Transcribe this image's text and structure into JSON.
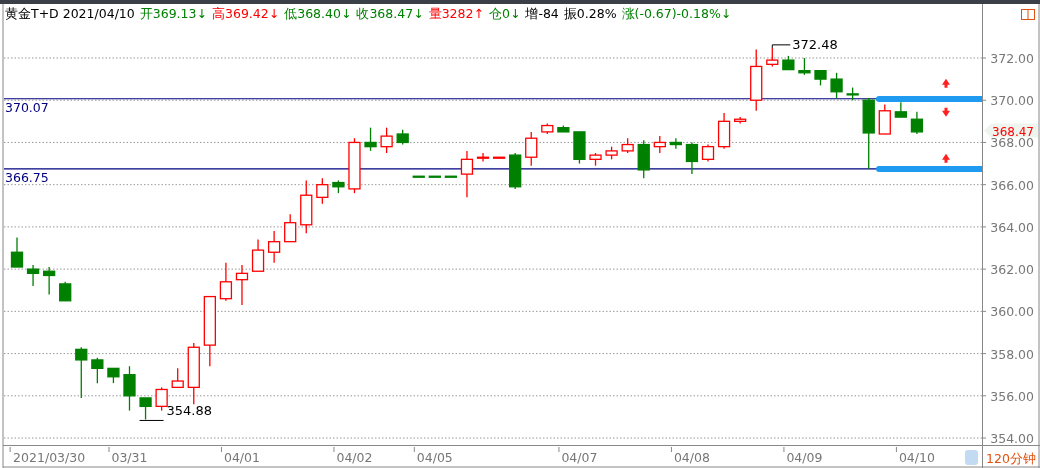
{
  "header": {
    "title": "黄金T+D 2021/04/10",
    "items": [
      {
        "text": "开369.13↓",
        "color": "#008000"
      },
      {
        "text": "高369.42↓",
        "color": "#ff0000"
      },
      {
        "text": "低368.40↓",
        "color": "#008000"
      },
      {
        "text": "收368.47↓",
        "color": "#008000"
      },
      {
        "text": "量3282↑",
        "color": "#ff0000"
      },
      {
        "text": "仓0↓",
        "color": "#008000"
      },
      {
        "text": "增-84",
        "color": "#000000"
      },
      {
        "text": "振0.28%",
        "color": "#000000"
      },
      {
        "text": "涨(-0.67)-0.18%↓",
        "color": "#008000"
      }
    ]
  },
  "chart_data": {
    "type": "candlestick",
    "categories": [
      null,
      null,
      "2021/03/30",
      null,
      null,
      null,
      null,
      "03/31",
      null,
      null,
      null,
      null,
      null,
      null,
      "04/01",
      null,
      null,
      null,
      null,
      null,
      null,
      "04/02",
      null,
      null,
      null,
      null,
      "04/05",
      null,
      null,
      null,
      null,
      null,
      null,
      null,
      null,
      "04/07",
      null,
      null,
      null,
      null,
      null,
      null,
      "04/08",
      null,
      null,
      null,
      null,
      null,
      null,
      "04/09",
      null,
      null,
      null,
      null,
      null,
      null,
      "04/10"
    ],
    "grid": true,
    "ohlc": [
      [
        362.8,
        363.5,
        362.1,
        362.1
      ],
      [
        362.0,
        362.2,
        361.2,
        361.8
      ],
      [
        361.9,
        362.1,
        360.8,
        361.7
      ],
      [
        361.3,
        361.4,
        360.5,
        360.5
      ],
      [
        358.2,
        358.3,
        355.9,
        357.7
      ],
      [
        357.7,
        357.8,
        356.6,
        357.3
      ],
      [
        357.3,
        357.3,
        356.6,
        356.9
      ],
      [
        357.0,
        357.4,
        355.3,
        356.0
      ],
      [
        355.9,
        355.9,
        354.88,
        355.5
      ],
      [
        355.5,
        356.4,
        355.3,
        356.3
      ],
      [
        356.4,
        357.3,
        356.4,
        356.7
      ],
      [
        356.4,
        358.5,
        355.6,
        358.3
      ],
      [
        358.4,
        360.7,
        357.4,
        360.7
      ],
      [
        360.6,
        362.3,
        360.5,
        361.4
      ],
      [
        361.5,
        362.2,
        360.3,
        361.8
      ],
      [
        361.9,
        363.4,
        361.9,
        362.9
      ],
      [
        362.8,
        363.8,
        362.3,
        363.3
      ],
      [
        363.3,
        364.6,
        363.3,
        364.2
      ],
      [
        364.1,
        366.2,
        363.7,
        365.5
      ],
      [
        365.4,
        366.3,
        365.1,
        366.0
      ],
      [
        366.1,
        366.2,
        365.6,
        365.9
      ],
      [
        365.8,
        368.2,
        365.6,
        368.0
      ],
      [
        368.0,
        368.7,
        367.6,
        367.8
      ],
      [
        367.8,
        368.7,
        367.5,
        368.3
      ],
      [
        368.4,
        368.6,
        367.9,
        368.0
      ],
      [
        366.4,
        366.4,
        366.39,
        366.39
      ],
      [
        366.4,
        366.4,
        366.39,
        366.39
      ],
      [
        366.4,
        366.4,
        366.39,
        366.39
      ],
      [
        366.5,
        367.6,
        365.4,
        367.2
      ],
      [
        367.3,
        367.5,
        367.1,
        367.3
      ],
      [
        367.3,
        367.3,
        367.3,
        367.3
      ],
      [
        367.4,
        367.5,
        365.8,
        365.9
      ],
      [
        367.3,
        368.5,
        366.9,
        368.2
      ],
      [
        368.5,
        368.9,
        368.4,
        368.8
      ],
      [
        368.7,
        368.8,
        368.5,
        368.5
      ],
      [
        368.5,
        368.5,
        367.0,
        367.2
      ],
      [
        367.2,
        367.5,
        366.9,
        367.4
      ],
      [
        367.4,
        367.8,
        367.2,
        367.6
      ],
      [
        367.6,
        368.2,
        367.5,
        367.9
      ],
      [
        367.9,
        368.1,
        366.3,
        366.7
      ],
      [
        367.8,
        368.3,
        367.5,
        368.0
      ],
      [
        368.0,
        368.2,
        367.7,
        367.9
      ],
      [
        367.9,
        368.0,
        366.5,
        367.1
      ],
      [
        367.2,
        367.9,
        367.1,
        367.8
      ],
      [
        367.8,
        369.4,
        367.7,
        369.0
      ],
      [
        369.0,
        369.2,
        368.9,
        369.1
      ],
      [
        370.0,
        372.4,
        369.5,
        371.6
      ],
      [
        371.7,
        372.48,
        371.6,
        371.9
      ],
      [
        371.9,
        372.1,
        371.45,
        371.45
      ],
      [
        371.4,
        372.0,
        371.2,
        371.3
      ],
      [
        371.4,
        371.4,
        370.7,
        371.0
      ],
      [
        371.0,
        371.3,
        370.1,
        370.4
      ],
      [
        370.3,
        370.6,
        370.0,
        370.29
      ],
      [
        370.0,
        370.1,
        366.75,
        368.45
      ],
      [
        368.4,
        369.8,
        368.4,
        369.5
      ],
      [
        369.45,
        369.9,
        369.2,
        369.2
      ],
      [
        369.1,
        369.45,
        368.4,
        368.5
      ]
    ],
    "ylim": [
      353.67,
      374.51
    ],
    "yticks": [
      {
        "value": 372,
        "label": "372.00"
      },
      {
        "value": 370,
        "label": "370.00"
      },
      {
        "value": 368,
        "label": "368.00"
      },
      {
        "value": 366,
        "label": "366.00"
      },
      {
        "value": 364,
        "label": "364.00"
      },
      {
        "value": 362,
        "label": "362.00"
      },
      {
        "value": 360,
        "label": "360.00"
      },
      {
        "value": 358,
        "label": "358.00"
      },
      {
        "value": 356,
        "label": "356.00"
      },
      {
        "value": 354,
        "label": "354.00"
      }
    ],
    "ref_lines": [
      {
        "axis": "y",
        "value": 370.07,
        "label": "370.07"
      },
      {
        "axis": "y",
        "value": 366.75,
        "label": "366.75"
      }
    ],
    "annotations": [
      "372.48",
      "354.88"
    ]
  },
  "last_price": "368.47",
  "period": "120分钟"
}
